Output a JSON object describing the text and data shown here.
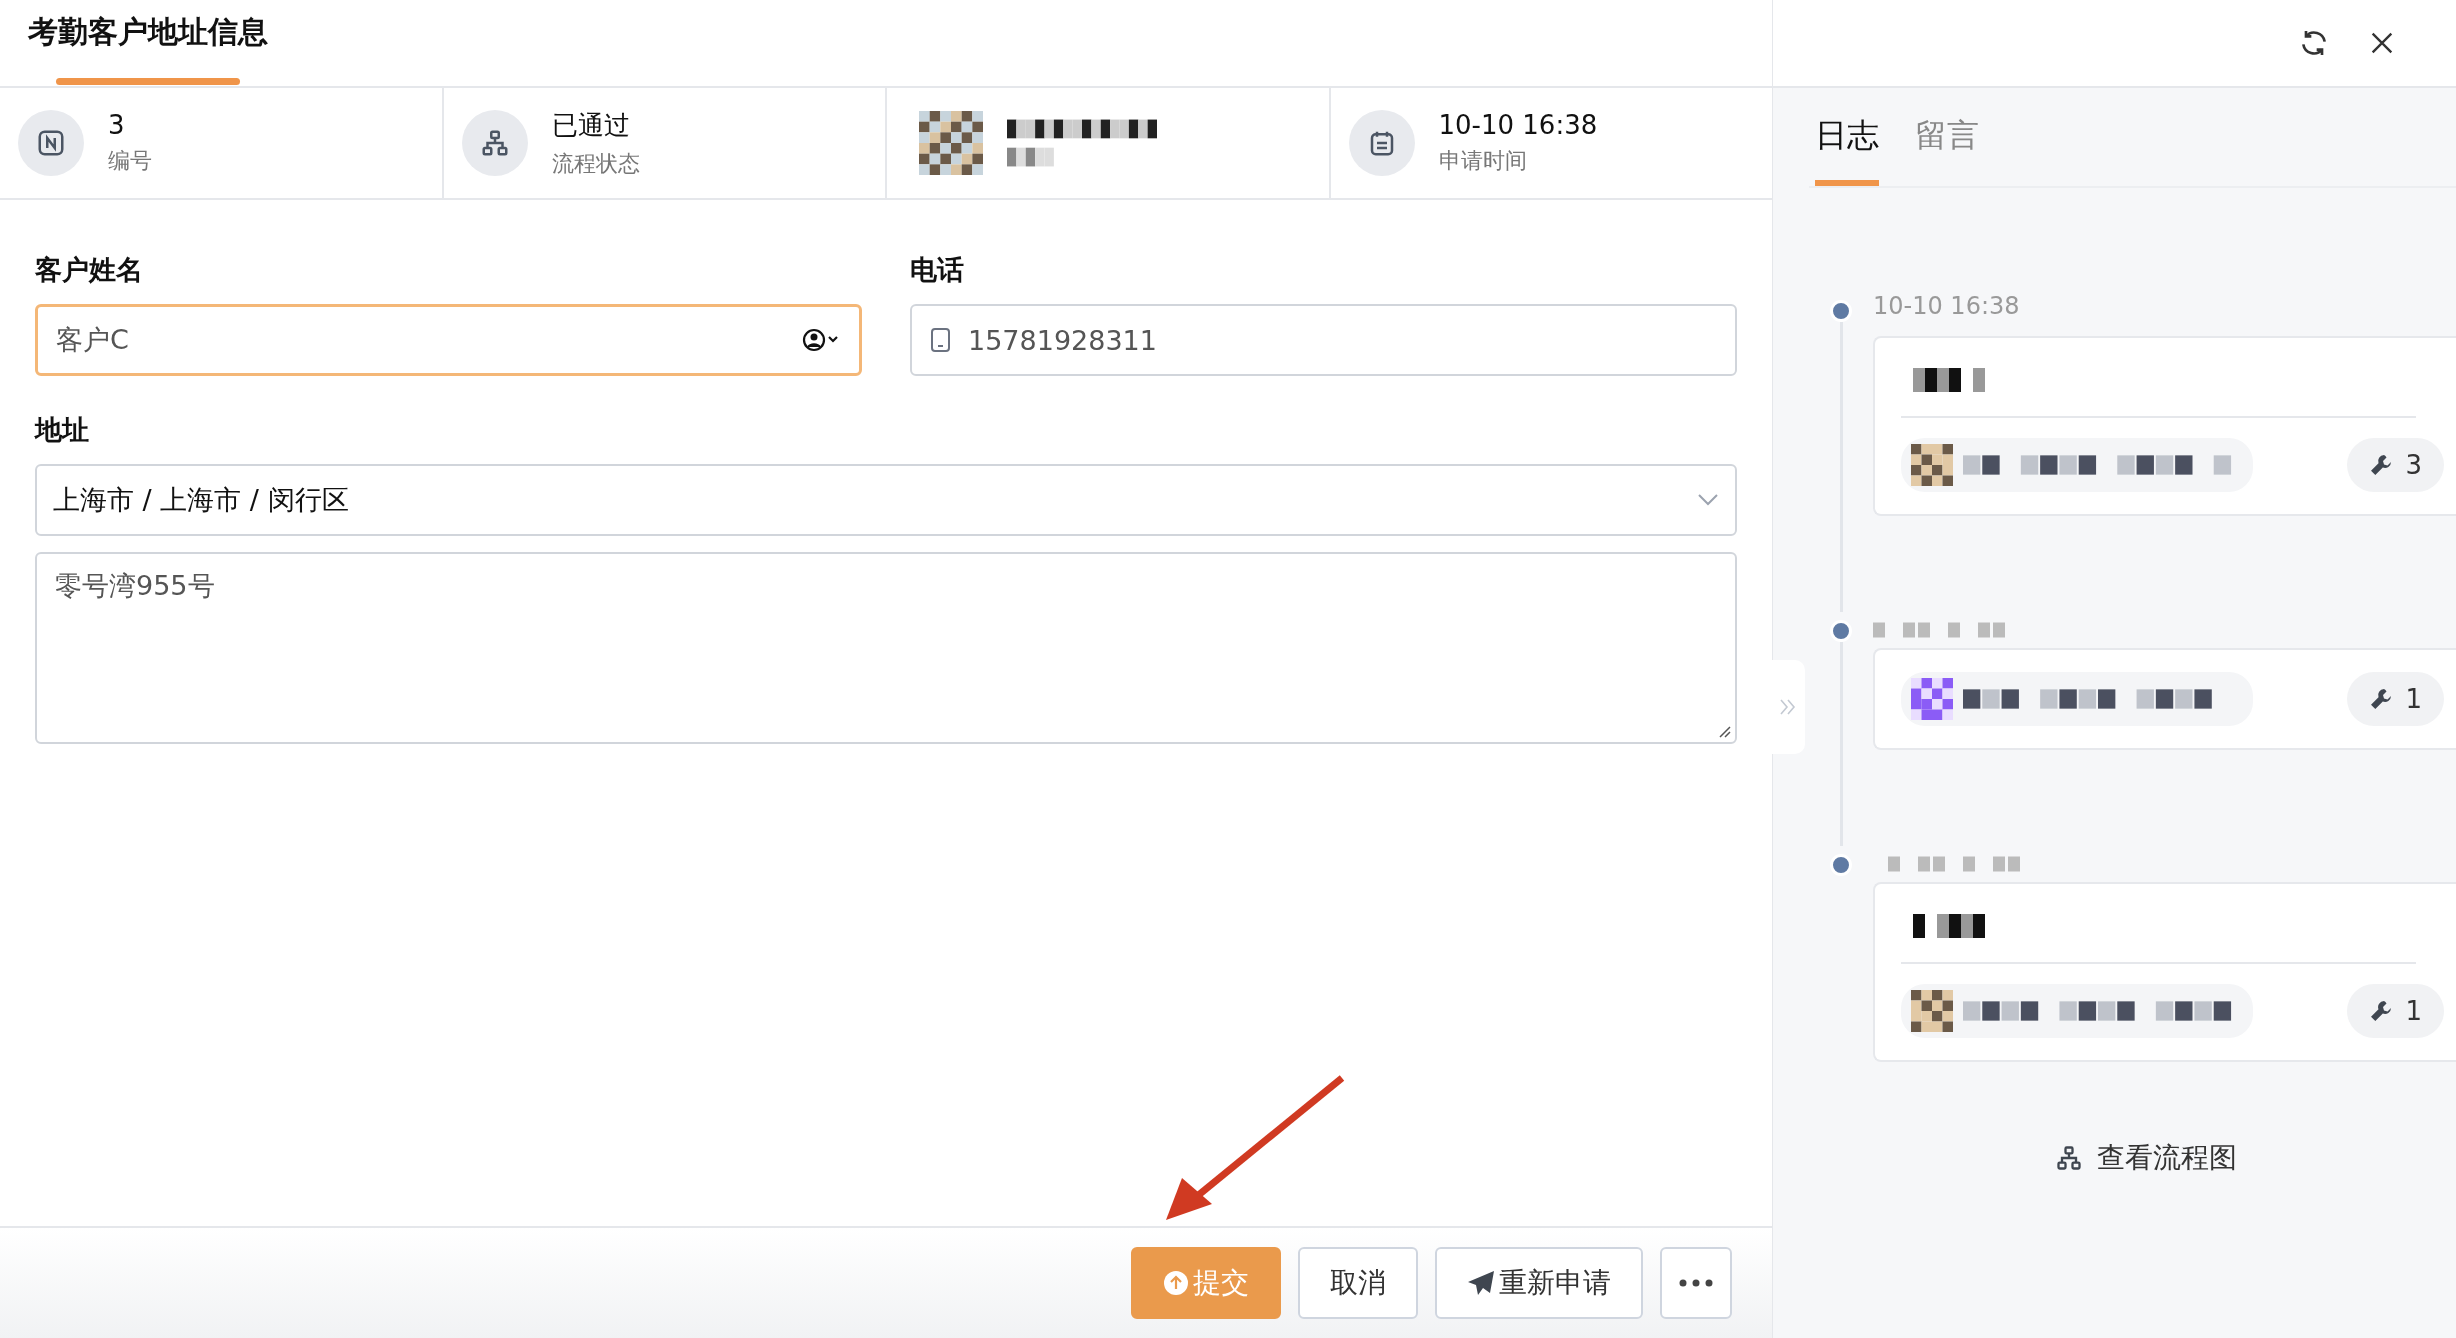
{
  "window": {
    "title": "考勤客户地址信息"
  },
  "info": [
    {
      "kind": "number",
      "value": "3",
      "label": "编号"
    },
    {
      "kind": "status",
      "value": "已通过",
      "label": "流程状态"
    },
    {
      "kind": "user"
    },
    {
      "kind": "time",
      "value": "10-10 16:38",
      "label": "申请时间"
    }
  ],
  "form": {
    "name_label": "客户姓名",
    "name_value": "客户C",
    "phone_label": "电话",
    "phone_value": "15781928311",
    "address_label": "地址",
    "region_value": "上海市 / 上海市 / 闵行区",
    "detail_value": "零号湾955号"
  },
  "buttons": [
    {
      "kind": "primary",
      "label": "提交"
    },
    {
      "kind": "plain",
      "label": "取消"
    },
    {
      "kind": "send",
      "label": "重新申请"
    },
    {
      "kind": "more"
    }
  ],
  "side_tabs": [
    {
      "label": "日志",
      "selected": true
    },
    {
      "label": "留言",
      "selected": false
    }
  ],
  "log": [
    {
      "kind": "titled",
      "time": "10-10 16:38",
      "count": "3"
    },
    {
      "kind": "plain",
      "count": "1"
    },
    {
      "kind": "titled",
      "count": "1"
    }
  ],
  "flow_link": "查看流程图"
}
